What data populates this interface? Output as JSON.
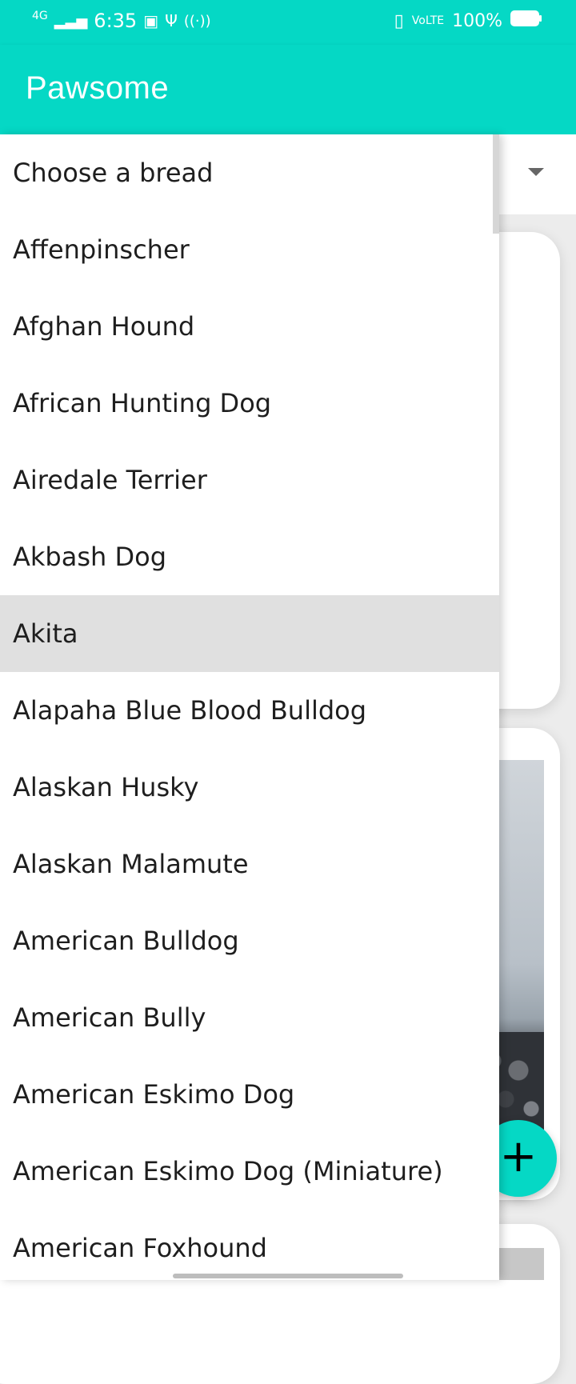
{
  "status_bar": {
    "network": "4G",
    "time": "6:35",
    "battery_percent": "100%",
    "icons": [
      "signal-icon",
      "notification-icon",
      "usb-icon",
      "hotspot-icon",
      "vibrate-icon",
      "volte-icon",
      "battery-icon"
    ]
  },
  "app": {
    "title": "Pawsome",
    "accent_color": "#05d8c5"
  },
  "dropdown": {
    "selected": "Akita",
    "options": [
      "Choose a bread",
      "Affenpinscher",
      "Afghan Hound",
      "African Hunting Dog",
      "Airedale Terrier",
      "Akbash Dog",
      "Akita",
      "Alapaha Blue Blood Bulldog",
      "Alaskan Husky",
      "Alaskan Malamute",
      "American Bulldog",
      "American Bully",
      "American Eskimo Dog",
      "American Eskimo Dog (Miniature)",
      "American Foxhound"
    ]
  },
  "fab": {
    "label": "+"
  }
}
